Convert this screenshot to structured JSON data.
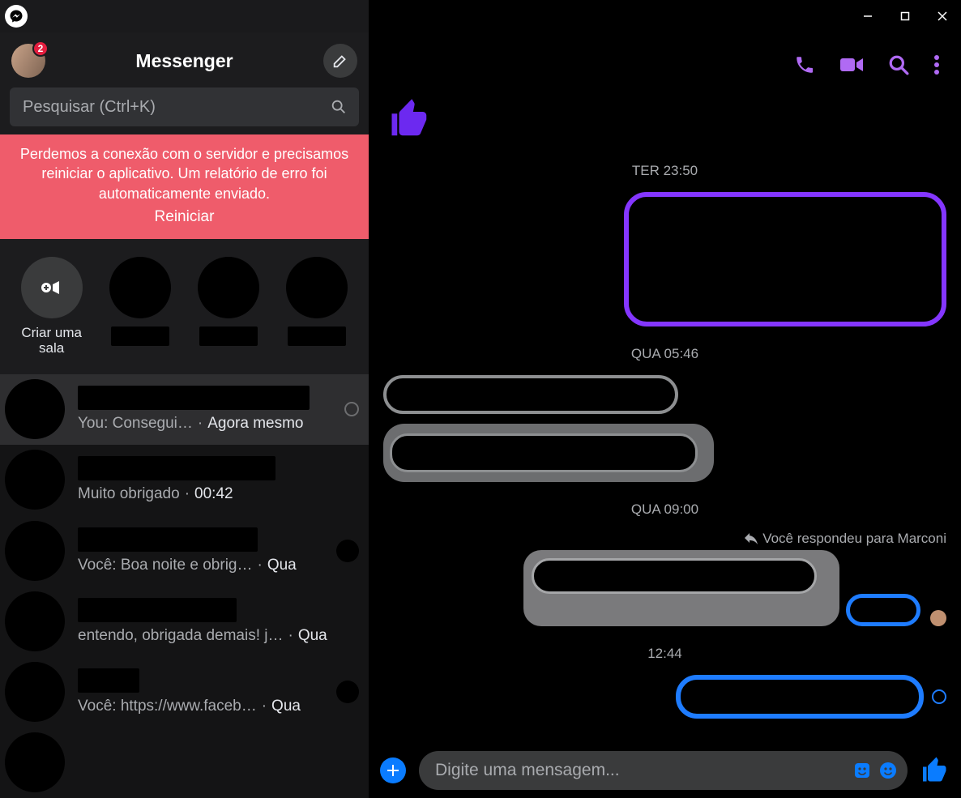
{
  "titlebar": {
    "logo": "messenger-bolt"
  },
  "sidebar": {
    "badge_count": "2",
    "title": "Messenger",
    "search_placeholder": "Pesquisar (Ctrl+K)",
    "alert_line1": "Perdemos a conexão com o servidor e precisamos reiniciar o aplicativo. Um relatório de erro foi automaticamente enviado.",
    "alert_action": "Reiniciar",
    "rooms": {
      "create_label": "Criar uma sala"
    },
    "conversations": [
      {
        "active": true,
        "preview_prefix": "You: Consegui…",
        "time": "Agora mesmo",
        "status": "ring",
        "name_width": 286
      },
      {
        "preview_prefix": "Muito obrigado",
        "time": "00:42",
        "status": "none",
        "name_width": 244
      },
      {
        "preview_prefix": "Você: Boa noite e obrig…",
        "time": "Qua",
        "status": "filled",
        "name_width": 222
      },
      {
        "preview_prefix": "entendo, obrigada demais! j…",
        "time": "Qua",
        "status": "none",
        "name_width": 196
      },
      {
        "preview_prefix": "Você: https://www.faceb…",
        "time": "Qua",
        "status": "filled",
        "name_width": 76
      }
    ]
  },
  "chat": {
    "header_icons": [
      "phone",
      "video",
      "search",
      "more"
    ],
    "timeline": [
      {
        "type": "big-like"
      },
      {
        "type": "ts",
        "text": "TER 23:50"
      },
      {
        "type": "bubble",
        "side": "right",
        "style": "purple-outline"
      },
      {
        "type": "ts",
        "text": "QUA 05:46"
      },
      {
        "type": "bubble",
        "side": "left",
        "style": "grey-outline-small"
      },
      {
        "type": "bubble",
        "side": "left",
        "style": "grey-fill-nested"
      },
      {
        "type": "ts",
        "text": "QUA 09:00"
      },
      {
        "type": "reply-indicator",
        "text": "Você respondeu para Marconi"
      },
      {
        "type": "quoted-reply"
      },
      {
        "type": "ts",
        "text": "12:44"
      },
      {
        "type": "bubble",
        "side": "right",
        "style": "blue-outline-last"
      }
    ],
    "composer": {
      "placeholder": "Digite uma mensagem..."
    }
  }
}
